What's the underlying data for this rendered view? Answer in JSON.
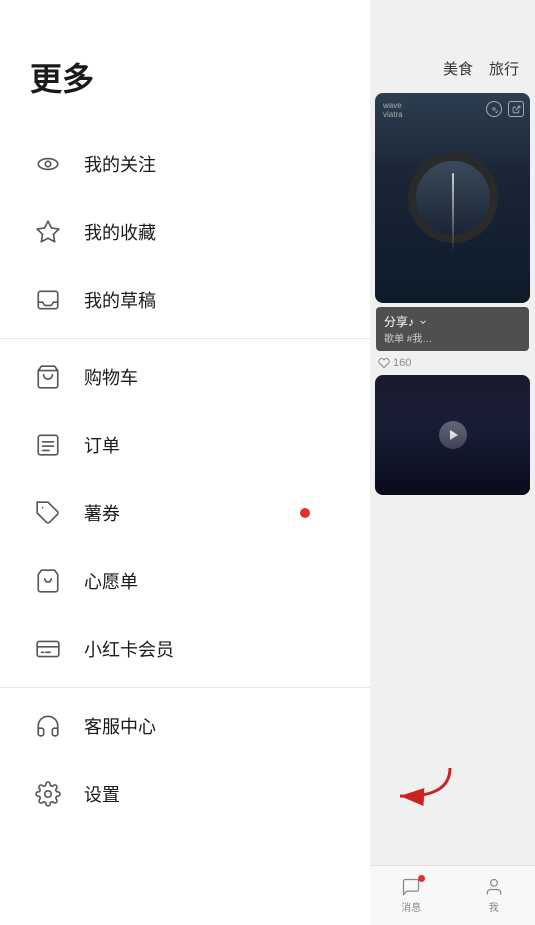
{
  "menu": {
    "title": "更多",
    "items": [
      {
        "id": "my-follows",
        "label": "我的关注",
        "icon": "eye",
        "badge": false
      },
      {
        "id": "my-favorites",
        "label": "我的收藏",
        "icon": "star",
        "badge": false
      },
      {
        "id": "my-drafts",
        "label": "我的草稿",
        "icon": "inbox",
        "badge": false
      },
      {
        "id": "divider-1",
        "type": "divider"
      },
      {
        "id": "shopping-cart",
        "label": "购物车",
        "icon": "cart",
        "badge": false
      },
      {
        "id": "orders",
        "label": "订单",
        "icon": "list",
        "badge": false
      },
      {
        "id": "coupons",
        "label": "薯券",
        "icon": "tag",
        "badge": true
      },
      {
        "id": "wishlist",
        "label": "心愿单",
        "icon": "bag",
        "badge": false
      },
      {
        "id": "membership",
        "label": "小红卡会员",
        "icon": "card",
        "badge": false
      },
      {
        "id": "divider-2",
        "type": "divider"
      },
      {
        "id": "customer-service",
        "label": "客服中心",
        "icon": "headset",
        "badge": false
      },
      {
        "id": "settings",
        "label": "设置",
        "icon": "gear",
        "badge": false
      }
    ]
  },
  "right_panel": {
    "nav_tags": [
      "美食",
      "旅行"
    ],
    "card1": {
      "user": "wave",
      "sub": "viatra"
    },
    "card2": {
      "title": "分享♪",
      "subtitle": "歌单 #我…",
      "likes": "160"
    },
    "bottom_nav": [
      {
        "label": "消息",
        "badge": true
      },
      {
        "label": "我",
        "badge": false
      }
    ]
  }
}
